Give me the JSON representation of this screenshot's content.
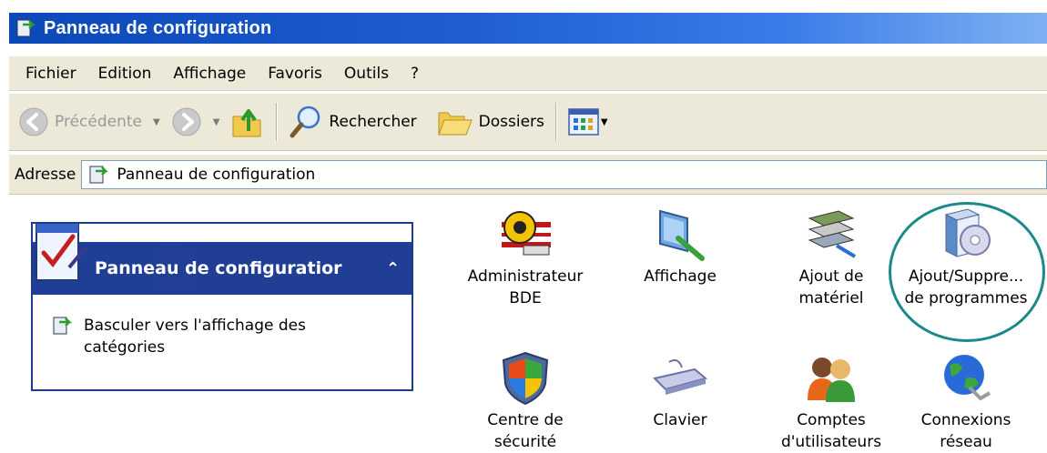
{
  "window": {
    "title": "Panneau de configuration"
  },
  "menu": [
    "Fichier",
    "Edition",
    "Affichage",
    "Favoris",
    "Outils",
    "?"
  ],
  "toolbar": {
    "back_label": "Précédente",
    "search_label": "Rechercher",
    "folders_label": "Dossiers"
  },
  "address": {
    "label": "Adresse",
    "value": "Panneau de configuration"
  },
  "sidepanel": {
    "title": "Panneau de configuratior",
    "link": "Basculer vers l'affichage des catégories"
  },
  "items": [
    {
      "line1": "Administrateur",
      "line2": "BDE",
      "icon": "bde-admin-icon"
    },
    {
      "line1": "Affichage",
      "line2": "",
      "icon": "display-icon"
    },
    {
      "line1": "Ajout de",
      "line2": "matériel",
      "icon": "add-hardware-icon"
    },
    {
      "line1": "Ajout/Suppre...",
      "line2": "de programmes",
      "icon": "add-remove-programs-icon"
    },
    {
      "line1": "Centre de",
      "line2": "sécurité",
      "icon": "security-center-icon"
    },
    {
      "line1": "Clavier",
      "line2": "",
      "icon": "keyboard-icon"
    },
    {
      "line1": "Comptes",
      "line2": "d'utilisateurs",
      "icon": "user-accounts-icon"
    },
    {
      "line1": "Connexions",
      "line2": "réseau",
      "icon": "network-connections-icon"
    }
  ],
  "colors": {
    "titlebar": "#0b48b8",
    "sidepanel_header": "#1f3f96",
    "highlight": "#1a8a88"
  }
}
